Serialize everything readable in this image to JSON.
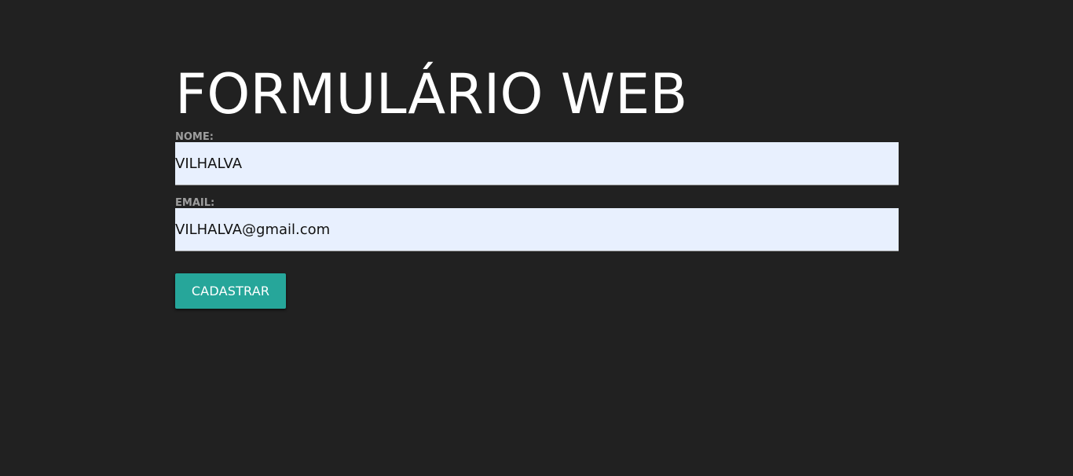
{
  "page": {
    "title": "FORMULÁRIO WEB"
  },
  "form": {
    "nome": {
      "label": "NOME:",
      "value": "VILHALVA"
    },
    "email": {
      "label": "EMAIL:",
      "value": "VILHALVA@gmail.com"
    },
    "submit_label": "CADASTRAR"
  },
  "colors": {
    "background": "#212121",
    "input_background": "#e8f0fe",
    "button": "#26a69a",
    "label": "#9e9e9e"
  }
}
